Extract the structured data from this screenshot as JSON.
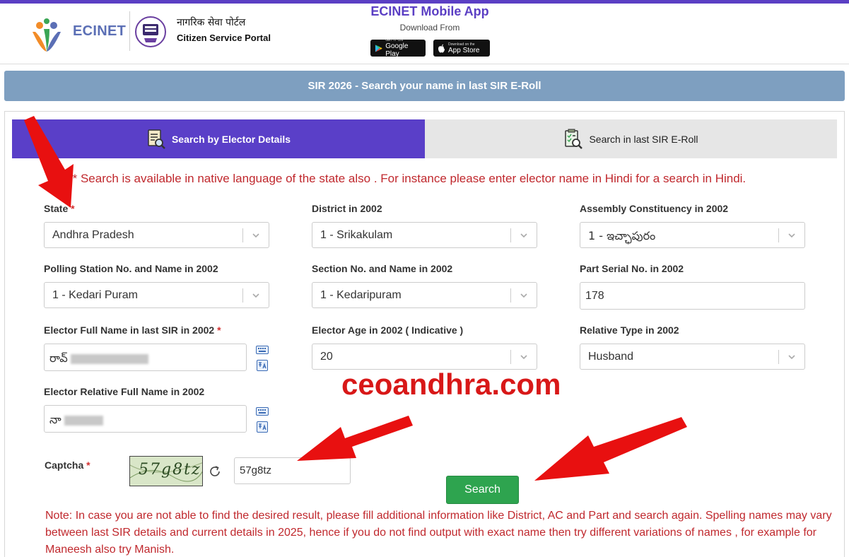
{
  "header": {
    "brand": "ECINET",
    "portal_hindi": "नागरिक सेवा पोर्टल",
    "portal_english": "Citizen Service Portal",
    "app_title": "ECINET Mobile App",
    "app_subtitle": "Download From",
    "google_play_small": "GET IT ON",
    "google_play_big": "Google Play",
    "app_store_small": "Download on the",
    "app_store_big": "App Store"
  },
  "banner": {
    "title": "SIR 2026 - Search your name in last SIR E-Roll"
  },
  "tabs": [
    {
      "label": "Search by Elector Details",
      "active": true
    },
    {
      "label": "Search in last SIR E-Roll",
      "active": false
    }
  ],
  "hint": "** Search is available in native language of the state also . For instance please enter elector name in Hindi for a search in Hindi.",
  "form": {
    "required_mark": "*",
    "state": {
      "label": "State",
      "value": "Andhra Pradesh"
    },
    "district": {
      "label": "District in 2002",
      "value": "1 - Srikakulam"
    },
    "assembly": {
      "label": "Assembly Constituency in 2002",
      "value": "1 - ఇచ్ఛాపురం"
    },
    "polling_station": {
      "label": "Polling Station No. and Name in 2002",
      "value": "1 - Kedari Puram"
    },
    "section": {
      "label": "Section No. and Name in 2002",
      "value": "1 - Kedaripuram"
    },
    "part_serial": {
      "label": "Part Serial No. in 2002",
      "value": "178"
    },
    "elector_name": {
      "label": "Elector Full Name in last SIR in 2002",
      "value": "రావ్"
    },
    "elector_age": {
      "label": "Elector Age in 2002 ( Indicative )",
      "value": "20"
    },
    "relative_type": {
      "label": "Relative Type in 2002",
      "value": "Husband"
    },
    "relative_name": {
      "label": "Elector Relative Full Name in 2002",
      "value": "నా"
    },
    "captcha": {
      "label": "Captcha",
      "image_text": "57g8tz",
      "value": "57g8tz"
    },
    "search_label": "Search"
  },
  "note": "Note: In case you are not able to find the desired result, please fill additional information like District, AC and Part and search again. Spelling names may vary between last SIR details and current details in 2025, hence if you do not find output with exact name then try different variations of names , for example for Maneesh also try Manish.",
  "watermark": "ceoandhra.com",
  "colors": {
    "accent": "#5a3fc8",
    "banner": "#7e9fc0",
    "warning": "#c0282d",
    "button": "#2ea44f",
    "annotation": "#e81010"
  }
}
